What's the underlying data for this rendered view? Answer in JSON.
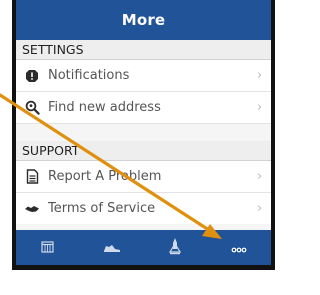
{
  "header": {
    "title": "More"
  },
  "sections": [
    {
      "title": "SETTINGS",
      "items": [
        {
          "label": "Notifications",
          "icon": "alert-icon"
        },
        {
          "label": "Find new address",
          "icon": "location-search-icon"
        }
      ]
    },
    {
      "title": "SUPPORT",
      "items": [
        {
          "label": "Report A Problem",
          "icon": "document-icon"
        },
        {
          "label": "Terms of Service",
          "icon": "handshake-icon"
        }
      ]
    }
  ],
  "tabbar": {
    "tabs": [
      {
        "name": "calendar-icon"
      },
      {
        "name": "shoe-icon"
      },
      {
        "name": "rocket-icon"
      },
      {
        "name": "more-icon"
      }
    ]
  },
  "colors": {
    "bar": "#215398",
    "annotation_arrow": "#E0900F"
  }
}
